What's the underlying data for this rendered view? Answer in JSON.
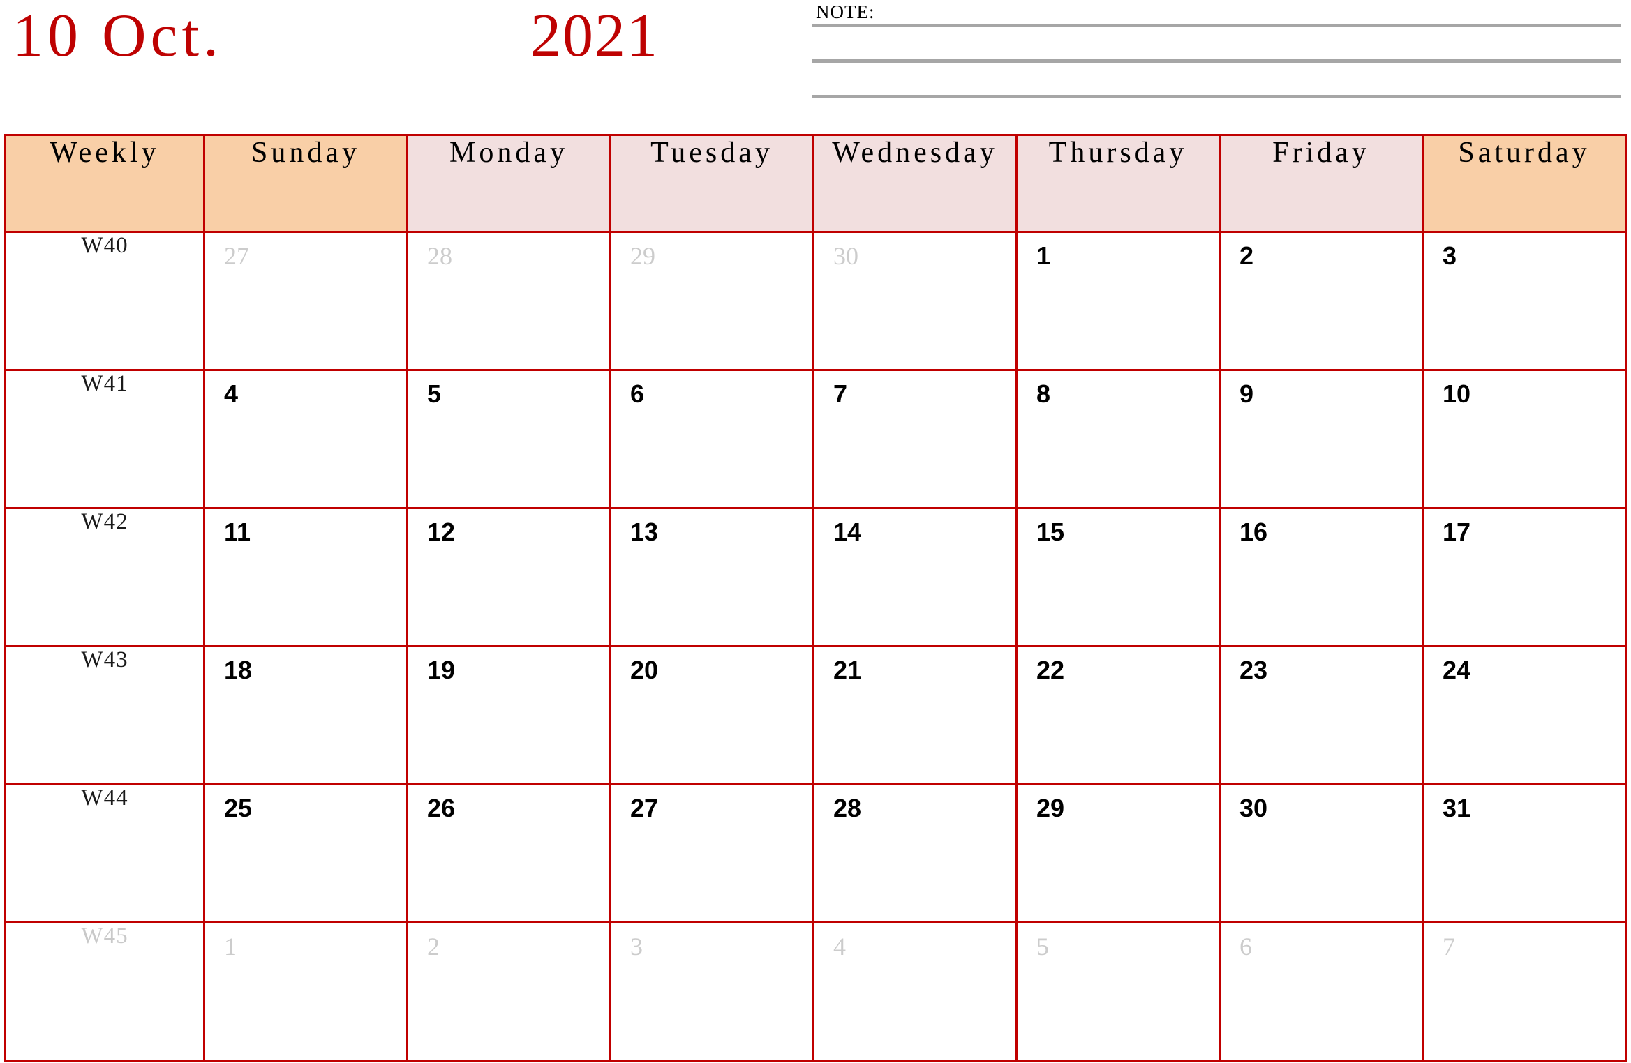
{
  "header": {
    "month_title": "10 Oct.",
    "year_title": "2021",
    "title_color": "#BE0202",
    "note_label": "NOTE:",
    "note_lines": [
      "",
      "",
      ""
    ],
    "note_line_color": "#A6A6A6"
  },
  "calendar": {
    "border_color": "#C00000",
    "weekend_header_bg": "#F9CFA7",
    "weekday_header_bg": "#F2DFDF",
    "muted_color": "#CCCCCC",
    "columns": [
      {
        "label": "Weekly",
        "type": "weekend"
      },
      {
        "label": "Sunday",
        "type": "weekend"
      },
      {
        "label": "Monday",
        "type": "weekday"
      },
      {
        "label": "Tuesday",
        "type": "weekday"
      },
      {
        "label": "Wednesday",
        "type": "weekday"
      },
      {
        "label": "Thursday",
        "type": "weekday"
      },
      {
        "label": "Friday",
        "type": "weekday"
      },
      {
        "label": "Saturday",
        "type": "weekend"
      }
    ],
    "rows": [
      {
        "week": "W40",
        "week_muted": false,
        "days": [
          {
            "n": "27",
            "muted": true
          },
          {
            "n": "28",
            "muted": true
          },
          {
            "n": "29",
            "muted": true
          },
          {
            "n": "30",
            "muted": true
          },
          {
            "n": "1",
            "muted": false
          },
          {
            "n": "2",
            "muted": false
          },
          {
            "n": "3",
            "muted": false
          }
        ]
      },
      {
        "week": "W41",
        "week_muted": false,
        "days": [
          {
            "n": "4",
            "muted": false
          },
          {
            "n": "5",
            "muted": false
          },
          {
            "n": "6",
            "muted": false
          },
          {
            "n": "7",
            "muted": false
          },
          {
            "n": "8",
            "muted": false
          },
          {
            "n": "9",
            "muted": false
          },
          {
            "n": "10",
            "muted": false
          }
        ]
      },
      {
        "week": "W42",
        "week_muted": false,
        "days": [
          {
            "n": "11",
            "muted": false
          },
          {
            "n": "12",
            "muted": false
          },
          {
            "n": "13",
            "muted": false
          },
          {
            "n": "14",
            "muted": false
          },
          {
            "n": "15",
            "muted": false
          },
          {
            "n": "16",
            "muted": false
          },
          {
            "n": "17",
            "muted": false
          }
        ]
      },
      {
        "week": "W43",
        "week_muted": false,
        "days": [
          {
            "n": "18",
            "muted": false
          },
          {
            "n": "19",
            "muted": false
          },
          {
            "n": "20",
            "muted": false
          },
          {
            "n": "21",
            "muted": false
          },
          {
            "n": "22",
            "muted": false
          },
          {
            "n": "23",
            "muted": false
          },
          {
            "n": "24",
            "muted": false
          }
        ]
      },
      {
        "week": "W44",
        "week_muted": false,
        "days": [
          {
            "n": "25",
            "muted": false
          },
          {
            "n": "26",
            "muted": false
          },
          {
            "n": "27",
            "muted": false
          },
          {
            "n": "28",
            "muted": false
          },
          {
            "n": "29",
            "muted": false
          },
          {
            "n": "30",
            "muted": false
          },
          {
            "n": "31",
            "muted": false
          }
        ]
      },
      {
        "week": "W45",
        "week_muted": true,
        "days": [
          {
            "n": "1",
            "muted": true
          },
          {
            "n": "2",
            "muted": true
          },
          {
            "n": "3",
            "muted": true
          },
          {
            "n": "4",
            "muted": true
          },
          {
            "n": "5",
            "muted": true
          },
          {
            "n": "6",
            "muted": true
          },
          {
            "n": "7",
            "muted": true
          }
        ]
      }
    ]
  }
}
